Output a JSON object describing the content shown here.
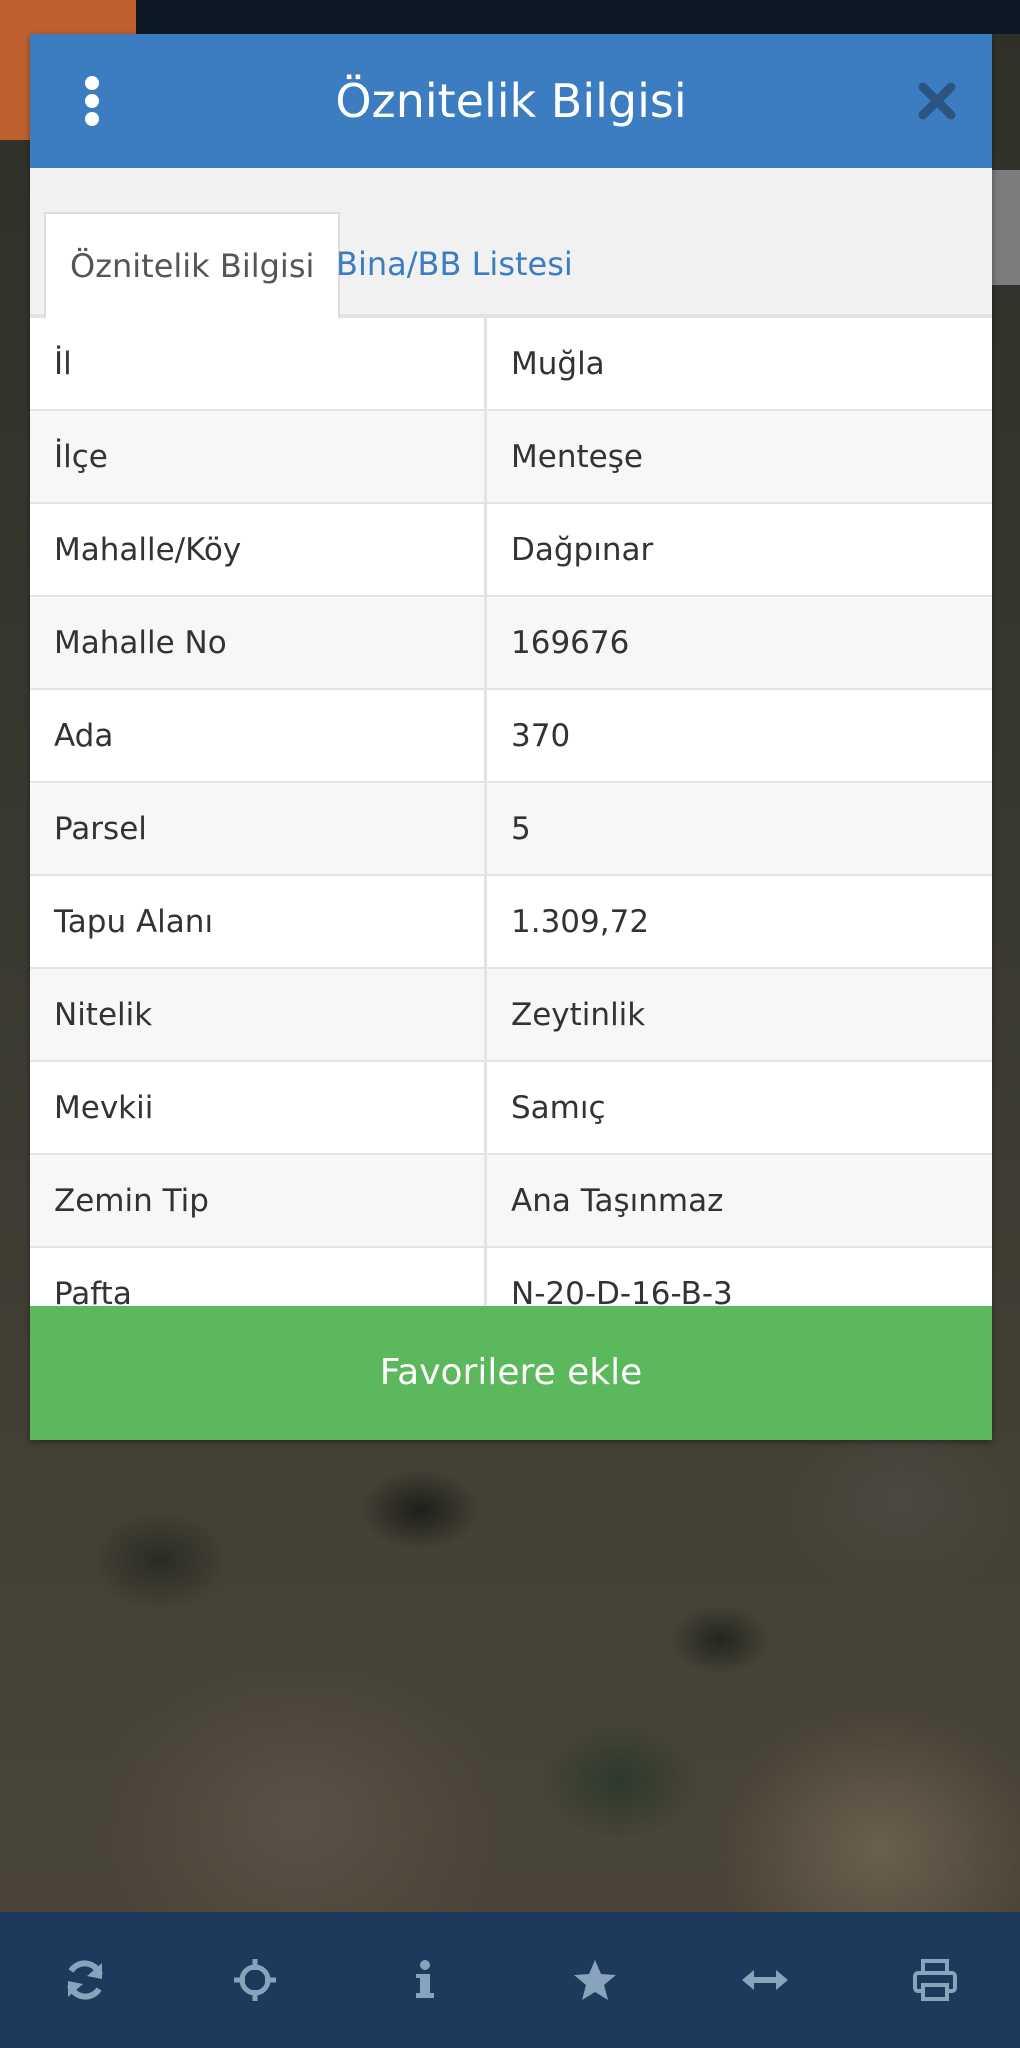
{
  "dialog": {
    "title": "Öznitelik Bilgisi",
    "close_icon": "close-icon",
    "menu_icon": "kebab-menu-icon"
  },
  "tabs": [
    {
      "label": "Öznitelik Bilgisi",
      "active": true
    },
    {
      "label": "Bina/BB Listesi",
      "active": false
    }
  ],
  "attributes": [
    {
      "label": "İl",
      "value": "Muğla"
    },
    {
      "label": "İlçe",
      "value": "Menteşe"
    },
    {
      "label": "Mahalle/Köy",
      "value": "Dağpınar"
    },
    {
      "label": "Mahalle No",
      "value": "169676"
    },
    {
      "label": "Ada",
      "value": "370"
    },
    {
      "label": "Parsel",
      "value": "5"
    },
    {
      "label": "Tapu Alanı",
      "value": "1.309,72"
    },
    {
      "label": "Nitelik",
      "value": "Zeytinlik"
    },
    {
      "label": "Mevkii",
      "value": "Samıç"
    },
    {
      "label": "Zemin Tip",
      "value": "Ana Taşınmaz"
    },
    {
      "label": "Pafta",
      "value": "N-20-D-16-B-3"
    }
  ],
  "favorite_button": {
    "label": "Favorilere ekle"
  },
  "toolbar": {
    "icons": [
      "refresh-icon",
      "locate-icon",
      "info-icon",
      "star-icon",
      "measure-icon",
      "print-icon"
    ]
  },
  "colors": {
    "header": "#3c7dc1",
    "accent_green": "#5cb85c",
    "toolbar": "#1c3a5c",
    "tab_link": "#3c7dc1"
  }
}
